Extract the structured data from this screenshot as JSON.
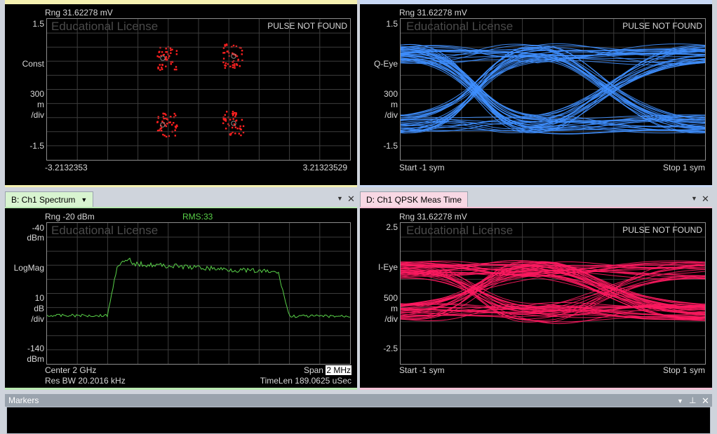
{
  "panels": {
    "tl": {
      "range": "Rng 31.62278 mV",
      "license": "Educational License",
      "status": "PULSE NOT FOUND",
      "y_top": "1.5",
      "y_mid": "Const",
      "y_scale": [
        "300",
        "m",
        "/div"
      ],
      "y_bot": "-1.5",
      "x_left": "-3.2132353",
      "x_right": "3.21323529",
      "color": "#ff2020"
    },
    "tr": {
      "range": "Rng 31.62278 mV",
      "license": "Educational License",
      "status": "PULSE NOT FOUND",
      "y_top": "1.5",
      "y_mid": "Q-Eye",
      "y_scale": [
        "300",
        "m",
        "/div"
      ],
      "y_bot": "-1.5",
      "x_left": "Start -1  sym",
      "x_right": "Stop 1  sym",
      "color": "#3f8fff"
    },
    "bl": {
      "tab": "B: Ch1 Spectrum",
      "range": "Rng -20 dBm",
      "rms": "RMS:33",
      "license": "Educational License",
      "y_top": [
        "-40",
        "dBm"
      ],
      "y_mid": "LogMag",
      "y_scale": [
        "10",
        "dB",
        "/div"
      ],
      "y_bot": [
        "-140",
        "dBm"
      ],
      "center": "Center 2 GHz",
      "span_label": "Span",
      "span_value": "2 MHz",
      "res_bw": "Res BW 20.2016 kHz",
      "timelen": "TimeLen 189.0625 uSec",
      "color": "#58d048"
    },
    "br": {
      "tab": "D: Ch1 QPSK Meas Time",
      "range": "Rng 31.62278 mV",
      "license": "Educational License",
      "status": "PULSE NOT FOUND",
      "y_top": "2.5",
      "y_mid": "I-Eye",
      "y_scale": [
        "500",
        "m",
        "/div"
      ],
      "y_bot": "-2.5",
      "x_left": "Start -1  sym",
      "x_right": "Stop 1  sym",
      "color": "#ff1a60"
    }
  },
  "markers": {
    "title": "Markers"
  },
  "icons": {
    "dropdown": "dropdown-icon",
    "close": "close-icon",
    "pin": "pin-icon"
  }
}
